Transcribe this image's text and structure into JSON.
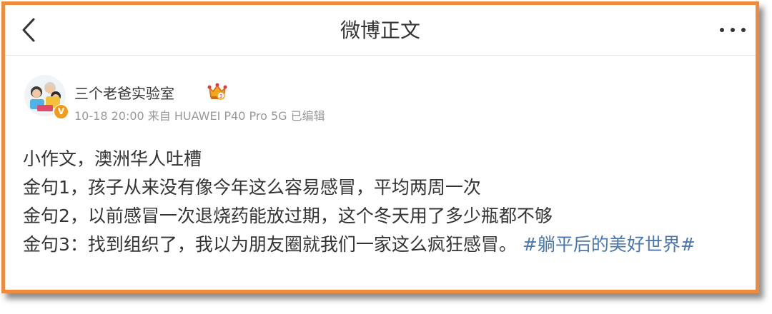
{
  "header": {
    "title": "微博正文",
    "back_icon": "chevron-left-icon",
    "more_icon": "more-dots-icon"
  },
  "post": {
    "author": "三个老爸实验室",
    "verified_badge": "V",
    "meta": "10-18 20:00 来自 HUAWEI P40 Pro 5G 已编辑",
    "lines": [
      "小作文，澳洲华人吐槽",
      "金句1，孩子从来没有像今年这么容易感冒，平均两周一次",
      "金句2，以前感冒一次退烧药能放过期，这个冬天用了多少瓶都不够"
    ],
    "last_line_text": "金句3：找到组织了，我以为朋友圈就我们一家这么疯狂感冒。",
    "hashtag": "#躺平后的美好世界#"
  },
  "colors": {
    "border": "#f08a3c",
    "hashtag": "#4b77b0",
    "text": "#333333",
    "meta": "#999999"
  }
}
